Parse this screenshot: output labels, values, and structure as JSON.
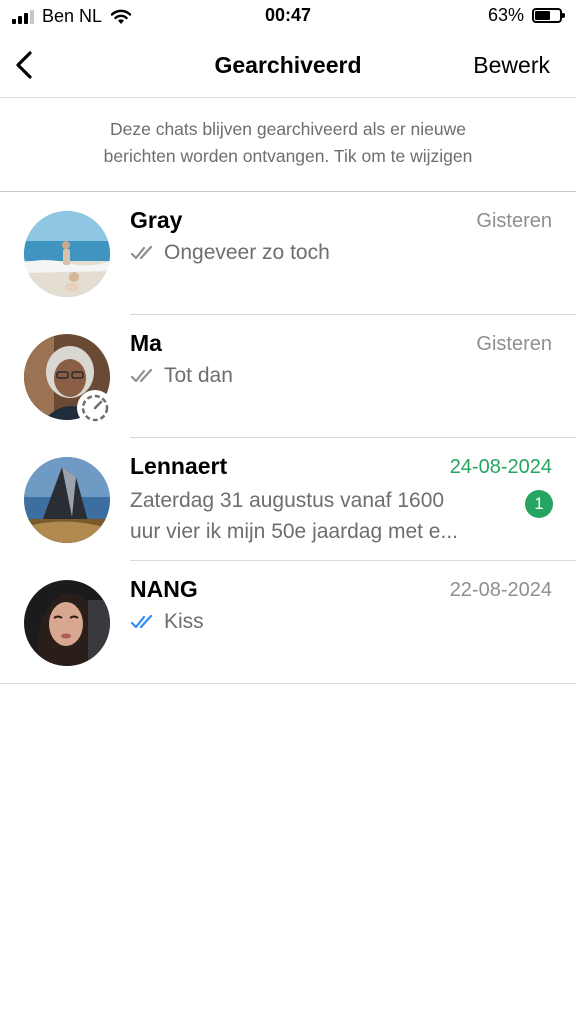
{
  "status_bar": {
    "carrier": "Ben NL",
    "time": "00:47",
    "battery": "63%",
    "battery_level": 0.63
  },
  "nav": {
    "title": "Gearchiveerd",
    "edit_label": "Bewerk"
  },
  "info_text": {
    "line1": "Deze chats blijven gearchiveerd als er nieuwe",
    "line2": "berichten worden ontvangen. Tik om te wijzigen"
  },
  "chats": [
    {
      "name": "Gray",
      "time": "Gisteren",
      "preview": "Ongeveer zo toch",
      "ticks": "read-grey"
    },
    {
      "name": "Ma",
      "time": "Gisteren",
      "preview": "Tot dan",
      "ticks": "read-grey"
    },
    {
      "name": "Lennaert",
      "time": "24-08-2024",
      "preview_line1": "Zaterdag 31 augustus vanaf 1600",
      "preview_line2": "uur vier ik mijn 50e jaardag met e...",
      "unread_count": "1"
    },
    {
      "name": "NANG",
      "time": "22-08-2024",
      "preview": "Kiss",
      "ticks": "read-blue"
    }
  ],
  "colors": {
    "unread_green": "#25a55f",
    "read_blue": "#2f8cf3",
    "grey_text": "#6d6d72"
  }
}
